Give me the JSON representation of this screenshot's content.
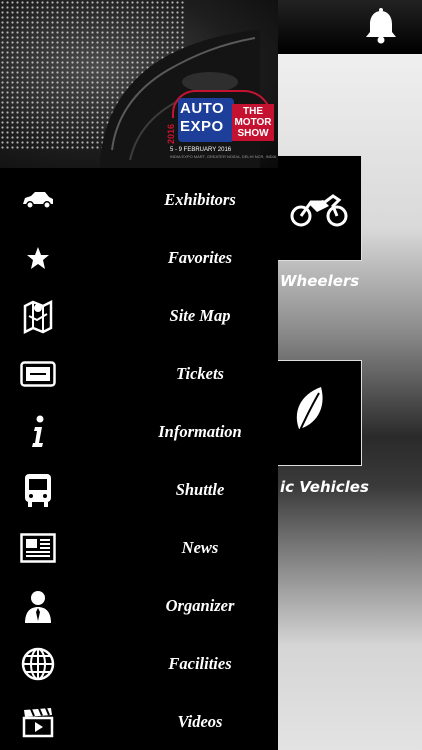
{
  "header": {
    "bell_icon": "bell-icon"
  },
  "hero": {
    "logo": {
      "year": "2016",
      "brand_top": "AUTO",
      "brand_bottom": "EXPO",
      "theme": "THE MOTOR SHOW",
      "dates": "5 - 9 FEBRUARY 2016",
      "venue": "INDIA EXPO MART, GREATER NOIDA, DELHI NCR, INDIA"
    }
  },
  "menu": {
    "items": [
      {
        "label": "Exhibitors",
        "icon": "car-icon"
      },
      {
        "label": "Favorites",
        "icon": "star-icon"
      },
      {
        "label": "Site Map",
        "icon": "map-icon"
      },
      {
        "label": "Tickets",
        "icon": "ticket-icon"
      },
      {
        "label": "Information",
        "icon": "info-icon"
      },
      {
        "label": "Shuttle",
        "icon": "bus-icon"
      },
      {
        "label": "News",
        "icon": "newspaper-icon"
      },
      {
        "label": "Organizer",
        "icon": "person-icon"
      },
      {
        "label": "Facilities",
        "icon": "globe-icon"
      },
      {
        "label": "Videos",
        "icon": "clapperboard-icon"
      }
    ]
  },
  "content": {
    "tiles": [
      {
        "label": "Wheelers",
        "icon": "motorcycle-icon"
      },
      {
        "label": "ic Vehicles",
        "icon": "leaf-icon"
      }
    ]
  }
}
